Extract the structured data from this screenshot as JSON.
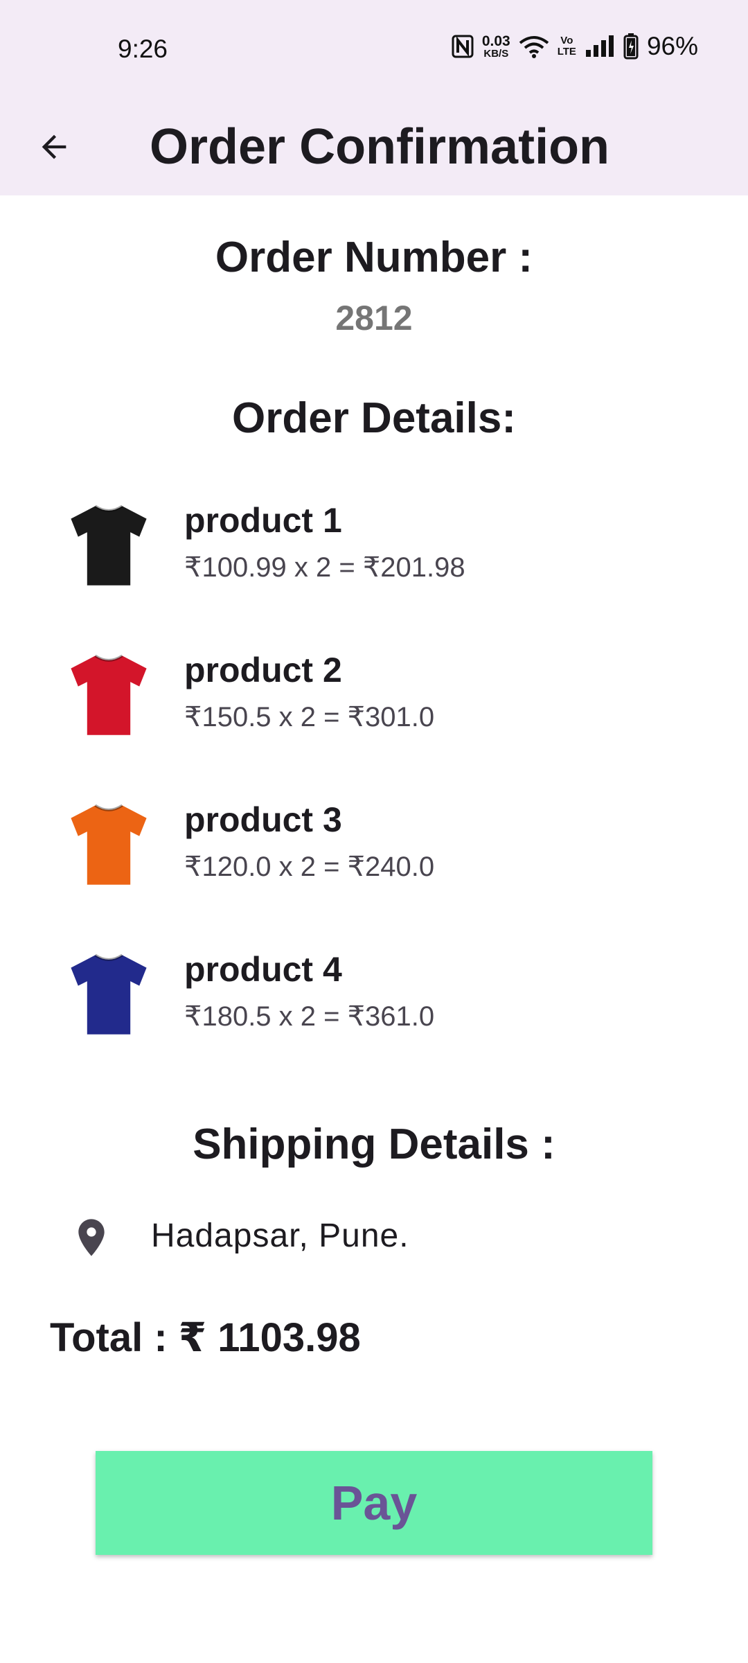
{
  "status_bar": {
    "time": "9:26",
    "net_speed_value": "0.03",
    "net_speed_unit": "KB/S",
    "volte_top": "Vo",
    "volte_bottom": "LTE",
    "battery": "96%"
  },
  "app_bar": {
    "title": "Order Confirmation",
    "back_icon": "arrow-back-icon"
  },
  "order": {
    "number_label": "Order Number :",
    "number": "2812",
    "details_heading": "Order Details:",
    "products": [
      {
        "name": "product 1",
        "price_line": "₹100.99 x 2 = ₹201.98",
        "shirt_color": "#1a1a1a",
        "icon": "tshirt-icon"
      },
      {
        "name": "product 2",
        "price_line": "₹150.5 x 2 = ₹301.0",
        "shirt_color": "#d3152a",
        "icon": "tshirt-icon"
      },
      {
        "name": "product 3",
        "price_line": "₹120.0 x 2 = ₹240.0",
        "shirt_color": "#ec6414",
        "icon": "tshirt-icon"
      },
      {
        "name": "product 4",
        "price_line": "₹180.5 x 2 = ₹361.0",
        "shirt_color": "#222a8c",
        "icon": "tshirt-icon"
      }
    ]
  },
  "shipping": {
    "heading": "Shipping Details :",
    "address": "Hadapsar, Pune.",
    "icon": "location-pin-icon"
  },
  "total": {
    "text": "Total : ₹ 1103.98"
  },
  "pay_button": {
    "label": "Pay",
    "color": "#69f0ae",
    "text_color": "#6a5496"
  }
}
